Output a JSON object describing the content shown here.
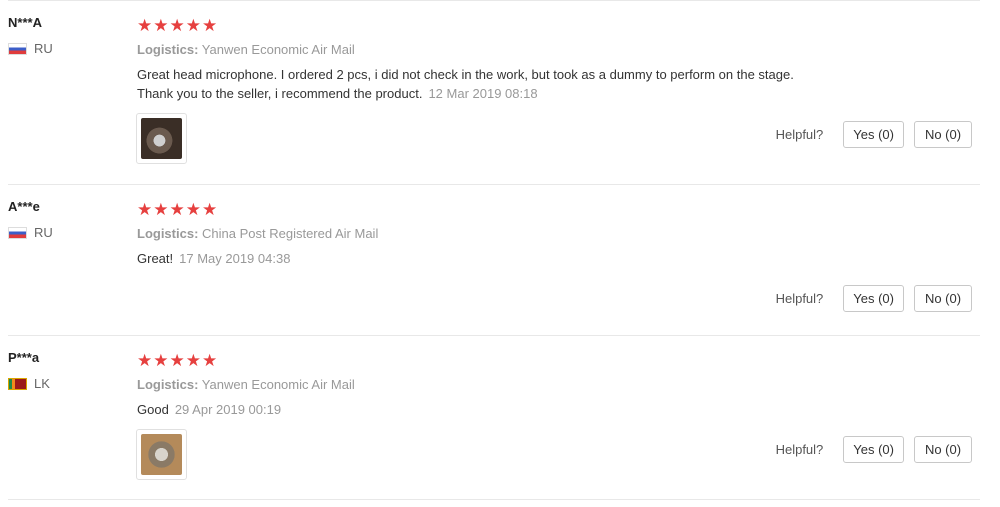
{
  "accent": "#e6403f",
  "reviews": [
    {
      "buyer": "N***A",
      "country": "RU",
      "stars": 5,
      "logistics_label": "Logistics:",
      "logistics_value": "Yanwen Economic Air Mail",
      "text_line1": "Great head microphone. I ordered 2 pcs, i did not check in the work, but took as a dummy to perform on the stage.",
      "text_line2": "Thank you to the seller, i recommend the product.",
      "date": "12 Mar 2019 08:18",
      "helpful_label": "Helpful?",
      "yes_label": "Yes (0)",
      "no_label": "No (0)"
    },
    {
      "buyer": "A***e",
      "country": "RU",
      "stars": 5,
      "logistics_label": "Logistics:",
      "logistics_value": "China Post Registered Air Mail",
      "text_line1": "Great!",
      "date": "17 May 2019 04:38",
      "helpful_label": "Helpful?",
      "yes_label": "Yes (0)",
      "no_label": "No (0)"
    },
    {
      "buyer": "P***a",
      "country": "LK",
      "stars": 5,
      "logistics_label": "Logistics:",
      "logistics_value": "Yanwen Economic Air Mail",
      "text_line1": "Good",
      "date": "29 Apr 2019 00:19",
      "helpful_label": "Helpful?",
      "yes_label": "Yes (0)",
      "no_label": "No (0)"
    }
  ]
}
